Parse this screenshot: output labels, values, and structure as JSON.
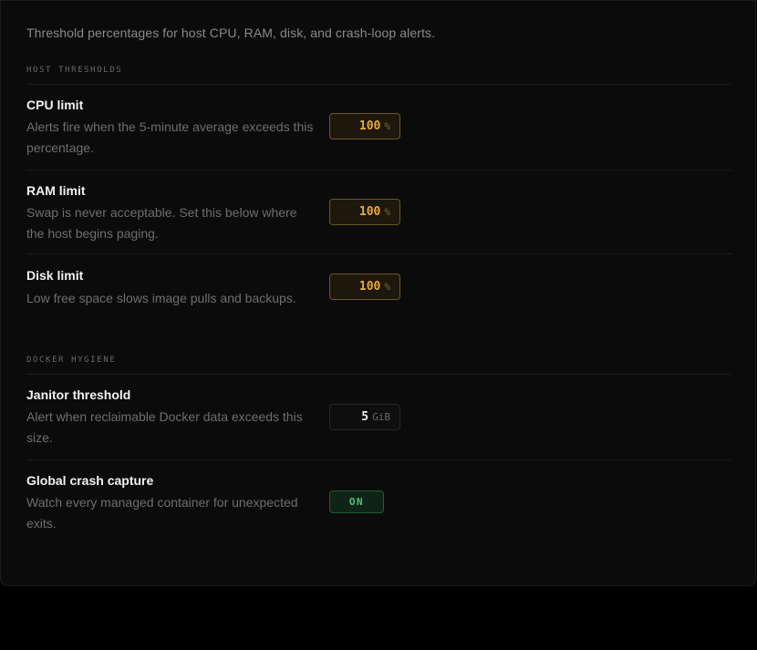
{
  "intro": "Threshold percentages for host CPU, RAM, disk, and crash-loop alerts.",
  "sections": {
    "host": {
      "title": "HOST THRESHOLDS",
      "rows": [
        {
          "label": "CPU limit",
          "desc": "Alerts fire when the 5-minute average exceeds this percentage.",
          "value": "100",
          "unit": "%"
        },
        {
          "label": "RAM limit",
          "desc": "Swap is never acceptable. Set this below where the host begins paging.",
          "value": "100",
          "unit": "%"
        },
        {
          "label": "Disk limit",
          "desc": "Low free space slows image pulls and backups.",
          "value": "100",
          "unit": "%"
        }
      ]
    },
    "docker": {
      "title": "DOCKER HYGIENE",
      "rows": [
        {
          "label": "Janitor threshold",
          "desc": "Alert when reclaimable Docker data exceeds this size.",
          "value": "5",
          "unit": "GiB"
        },
        {
          "label": "Global crash capture",
          "desc": "Watch every managed container for unexpected exits.",
          "toggle": "ON"
        }
      ]
    }
  },
  "colors": {
    "accent_amber": "#e8a93a",
    "toggle_green": "#4fc27a",
    "background": "#0b0b0b"
  }
}
